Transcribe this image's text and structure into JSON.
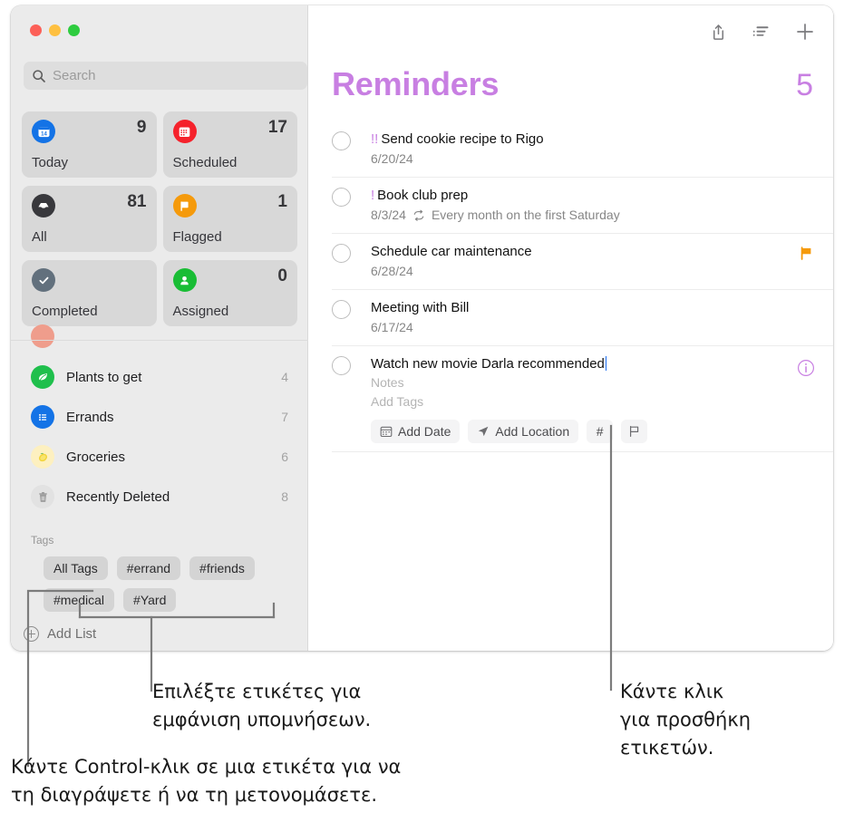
{
  "window": {
    "traffic_lights": [
      "close",
      "minimize",
      "zoom"
    ]
  },
  "sidebar": {
    "search": {
      "placeholder": "Search",
      "icon": "search-icon"
    },
    "smart_cards": [
      {
        "label": "Today",
        "count": "9",
        "icon": "calendar-icon",
        "color": "#1473e6"
      },
      {
        "label": "Scheduled",
        "count": "17",
        "icon": "calendar-days-icon",
        "color": "#f5222c"
      },
      {
        "label": "All",
        "count": "81",
        "icon": "inbox-tray-icon",
        "color": "#38383c"
      },
      {
        "label": "Flagged",
        "count": "1",
        "icon": "flag-icon",
        "color": "#f59a0b"
      },
      {
        "label": "Completed",
        "count": "",
        "icon": "checkmark-icon",
        "color": "#62707d"
      },
      {
        "label": "Assigned",
        "count": "0",
        "icon": "person-icon",
        "color": "#19bd35"
      }
    ],
    "lists": [
      {
        "name": "Plants to get",
        "count": "4",
        "icon": "leaf-icon",
        "color": "#1fbf4c"
      },
      {
        "name": "Errands",
        "count": "7",
        "icon": "list-bullet-icon",
        "color": "#1473e6"
      },
      {
        "name": "Groceries",
        "count": "6",
        "icon": "lemon-icon",
        "color": "#fdf0c0"
      },
      {
        "name": "Recently Deleted",
        "count": "8",
        "icon": "trash-icon",
        "color": "#e2e2e2"
      }
    ],
    "tags_header": "Tags",
    "tags": [
      "All Tags",
      "#errand",
      "#friends",
      "#medical",
      "#Yard"
    ],
    "add_list_label": "Add List"
  },
  "main": {
    "toolbar": [
      {
        "name": "share-icon"
      },
      {
        "name": "sort-list-icon"
      },
      {
        "name": "add-reminder-icon"
      }
    ],
    "title": "Reminders",
    "count": "5",
    "accent_color": "#c87fe2",
    "reminders": [
      {
        "priority": "!!",
        "title": "Send cookie recipe to Rigo",
        "date": "6/20/24",
        "repeat": "",
        "flagged": false,
        "info": false
      },
      {
        "priority": "!",
        "title": "Book club prep",
        "date": "8/3/24",
        "repeat": "Every month on the first Saturday",
        "flagged": false,
        "info": false
      },
      {
        "priority": "",
        "title": "Schedule car maintenance",
        "date": "6/28/24",
        "repeat": "",
        "flagged": true,
        "info": false
      },
      {
        "priority": "",
        "title": "Meeting with Bill",
        "date": "6/17/24",
        "repeat": "",
        "flagged": false,
        "info": false
      }
    ],
    "editing_reminder": {
      "title": "Watch new movie Darla recommended",
      "notes_placeholder": "Notes",
      "tags_placeholder": "Add Tags",
      "buttons": [
        {
          "label": "Add Date",
          "icon": "calendar-icon"
        },
        {
          "label": "Add Location",
          "icon": "location-arrow-icon"
        },
        {
          "label": "#",
          "icon": "hash-icon"
        },
        {
          "label": "",
          "icon": "flag-outline-icon"
        }
      ],
      "info_icon": "info-circle-icon"
    }
  },
  "callouts": [
    {
      "id": "tags-callout",
      "line1": "Επιλέξτε ετικέτες για",
      "line2": "εμφάνιση υπομνήσεων."
    },
    {
      "id": "add-tag-callout",
      "line1": "Κάντε κλικ",
      "line2": "για προσθήκη",
      "line3": "ετικετών."
    },
    {
      "id": "ctrl-click-callout",
      "line1": "Κάντε Control-κλικ σε μια ετικέτα για να",
      "line2": "τη διαγράψετε ή να τη μετονομάσετε."
    }
  ]
}
